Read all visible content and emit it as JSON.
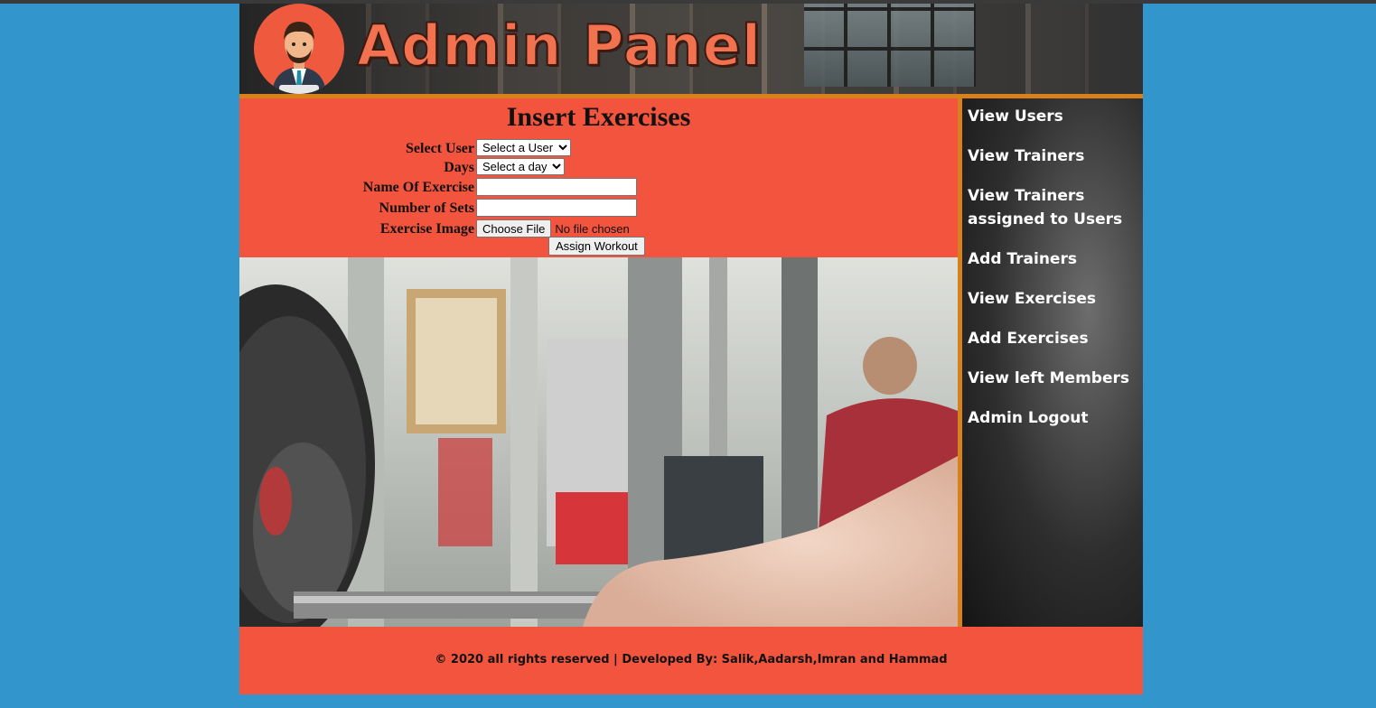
{
  "header": {
    "logo_title": "Admin Panel"
  },
  "form": {
    "title": "Insert Exercises",
    "select_user_label": "Select User",
    "select_user_value": "Select a User",
    "days_label": "Days",
    "days_value": "Select a day",
    "exercise_name_label": "Name Of Exercise",
    "sets_label": "Number of Sets",
    "image_label": "Exercise Image",
    "choose_file_label": "Choose File",
    "no_file_text": "No file chosen",
    "submit_label": "Assign Workout"
  },
  "sidebar": {
    "items": [
      {
        "label": "View Users"
      },
      {
        "label": "View Trainers"
      },
      {
        "label": "View Trainers assigned to Users"
      },
      {
        "label": "Add Trainers"
      },
      {
        "label": "View Exercises"
      },
      {
        "label": "Add Exercises"
      },
      {
        "label": "View left Members"
      },
      {
        "label": "Admin Logout"
      }
    ]
  },
  "footer": {
    "text": "© 2020 all rights reserved | Developed By: Salik,Aadarsh,Imran and Hammad"
  },
  "colors": {
    "page_bg": "#3296cd",
    "panel": "#f2543d",
    "accent_border": "#d88019"
  }
}
